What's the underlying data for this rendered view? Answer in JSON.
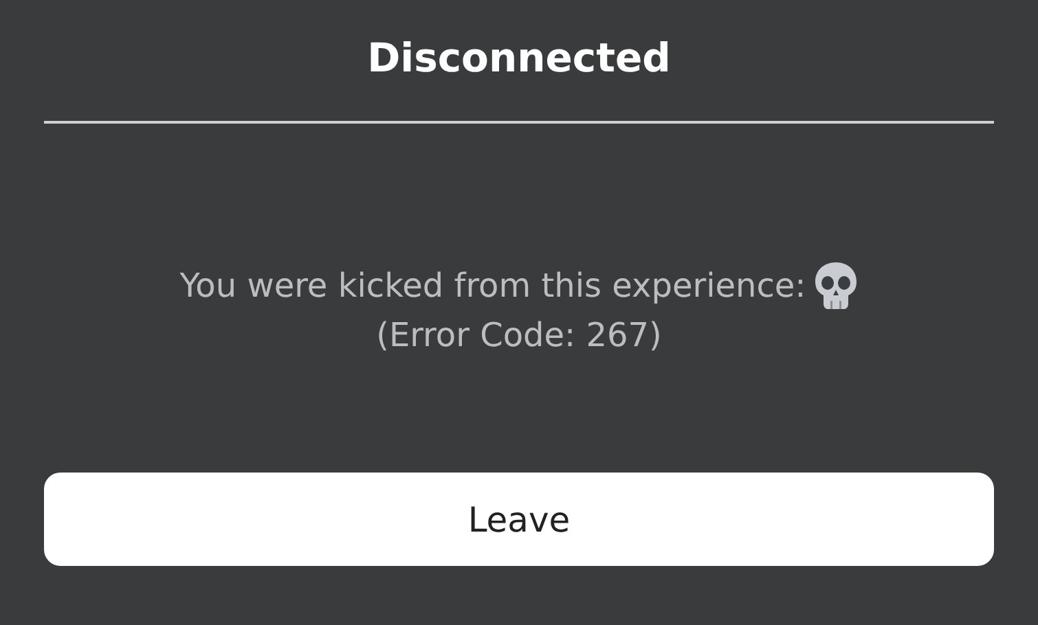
{
  "title": "Disconnected",
  "message": {
    "lines": [
      "You were kicked from this experience:",
      "(Error Code: 267)"
    ]
  },
  "buttons": [
    {
      "label": "Leave"
    }
  ]
}
